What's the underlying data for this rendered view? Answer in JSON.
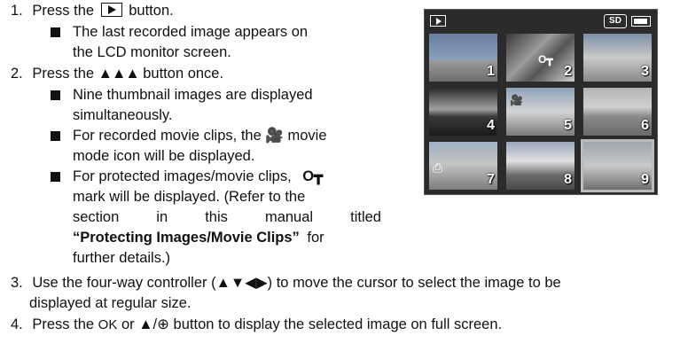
{
  "steps": {
    "s1": {
      "num": "1.",
      "pre": "Press the",
      "post": "button."
    },
    "s1b1_l1": "The last recorded image appears on",
    "s1b1_l2": "the LCD monitor screen.",
    "s2": {
      "num": "2.",
      "pre": "Press the",
      "post": "button once."
    },
    "s2b1_l1": "Nine thumbnail images are displayed",
    "s2b1_l2": "simultaneously.",
    "s2b2_l1_pre": "For recorded movie clips, the",
    "s2b2_l1_post": "movie",
    "s2b2_l2": "mode icon will be displayed.",
    "s2b3_l1": "For protected images/movie clips,",
    "s2b3_l2": "mark will be displayed. (Refer to the",
    "s2b3_l3_words": [
      "section",
      "in",
      "this",
      "manual",
      "titled"
    ],
    "s2b3_l4_bold": "“Protecting Images/Movie Clips”",
    "s2b3_l4_post": "for",
    "s2b3_l5": "further details.)",
    "s3": {
      "num": "3.",
      "l1": "Use the four-way controller (▲▼◀▶) to move the cursor to select the image to be",
      "l2": "displayed at regular size."
    },
    "s4": {
      "num": "4.",
      "pre": "Press the",
      "ok": "OK",
      "mid": "or",
      "post": "button to display the selected image on full screen."
    }
  },
  "lcd": {
    "sd_label": "SD",
    "thumbnails": [
      "1",
      "2",
      "3",
      "4",
      "5",
      "6",
      "7",
      "8",
      "9"
    ],
    "selected": "9"
  },
  "colors": {
    "panel": "#2b2b2b",
    "text": "#111111"
  }
}
